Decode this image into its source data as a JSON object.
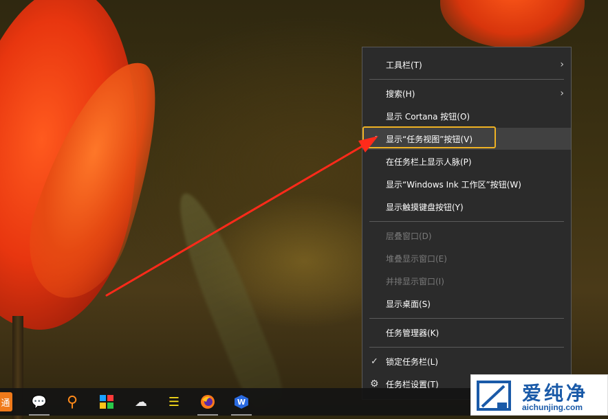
{
  "context_menu": {
    "items": [
      {
        "label": "工具栏(T)",
        "submenu": true
      },
      {
        "label": "搜索(H)",
        "submenu": true
      },
      {
        "label": "显示 Cortana 按钮(O)"
      },
      {
        "label": "显示“任务视图”按钮(V)",
        "checked": true,
        "highlighted": true
      },
      {
        "label": "在任务栏上显示人脉(P)"
      },
      {
        "label": "显示“Windows Ink 工作区”按钮(W)"
      },
      {
        "label": "显示触摸键盘按钮(Y)"
      },
      {
        "label": "层叠窗口(D)",
        "disabled": true
      },
      {
        "label": "堆叠显示窗口(E)",
        "disabled": true
      },
      {
        "label": "并排显示窗口(I)",
        "disabled": true
      },
      {
        "label": "显示桌面(S)"
      },
      {
        "label": "任务管理器(K)"
      },
      {
        "label": "锁定任务栏(L)",
        "checked": true
      },
      {
        "label": "任务栏设置(T)",
        "icon": "gear-icon"
      }
    ],
    "check_glyph": "✓",
    "chevron_glyph": "›",
    "gear_glyph": "⚙"
  },
  "annotation": {
    "highlight_color": "#f0b323",
    "arrow_color": "#ff2a1a"
  },
  "taskbar": {
    "icons": [
      {
        "name": "partial-app-icon",
        "glyph": "通"
      },
      {
        "name": "wechat-icon",
        "glyph": "💬"
      },
      {
        "name": "search-magnifier-app-icon",
        "glyph": "⚲"
      },
      {
        "name": "colorful-tiles-app-icon",
        "glyph": "▦"
      },
      {
        "name": "cloud-app-icon",
        "glyph": "☁"
      },
      {
        "name": "notes-lines-app-icon",
        "glyph": "☰"
      },
      {
        "name": "firefox-icon",
        "glyph": "●"
      },
      {
        "name": "wps-office-icon",
        "glyph": "W"
      }
    ]
  },
  "watermark": {
    "title": "爱纯净",
    "url": "aichunjing.com"
  }
}
